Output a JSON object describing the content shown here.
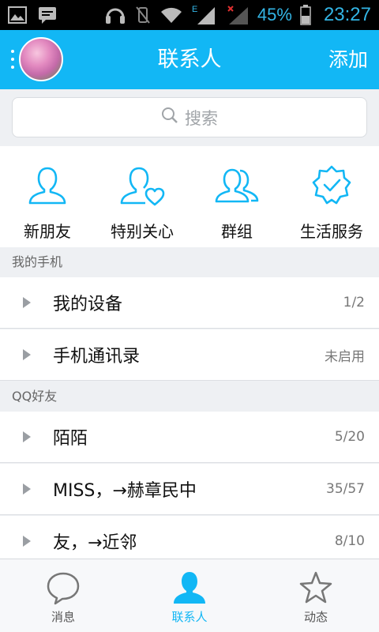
{
  "status_bar": {
    "network_letter": "E",
    "battery": "45%",
    "time": "23:27"
  },
  "header": {
    "title": "联系人",
    "add_label": "添加"
  },
  "search": {
    "placeholder": "搜索"
  },
  "quick_items": [
    {
      "label": "新朋友",
      "icon": "new-friend-icon"
    },
    {
      "label": "特别关心",
      "icon": "special-care-icon"
    },
    {
      "label": "群组",
      "icon": "group-icon"
    },
    {
      "label": "生活服务",
      "icon": "life-service-icon"
    }
  ],
  "sections": [
    {
      "title": "我的手机",
      "rows": [
        {
          "name": "我的设备",
          "count": "1/2"
        },
        {
          "name": "手机通讯录",
          "count": "未启用"
        }
      ]
    },
    {
      "title": "QQ好友",
      "rows": [
        {
          "name": "陌陌",
          "count": "5/20"
        },
        {
          "name": "MISS，→赫章民中",
          "count": "35/57"
        },
        {
          "name": "友，→近邻",
          "count": "8/10"
        }
      ]
    }
  ],
  "tabs": [
    {
      "label": "消息",
      "active": false
    },
    {
      "label": "联系人",
      "active": true
    },
    {
      "label": "动态",
      "active": false
    }
  ],
  "colors": {
    "accent": "#12b7f5",
    "status_blue": "#33b5e5"
  }
}
